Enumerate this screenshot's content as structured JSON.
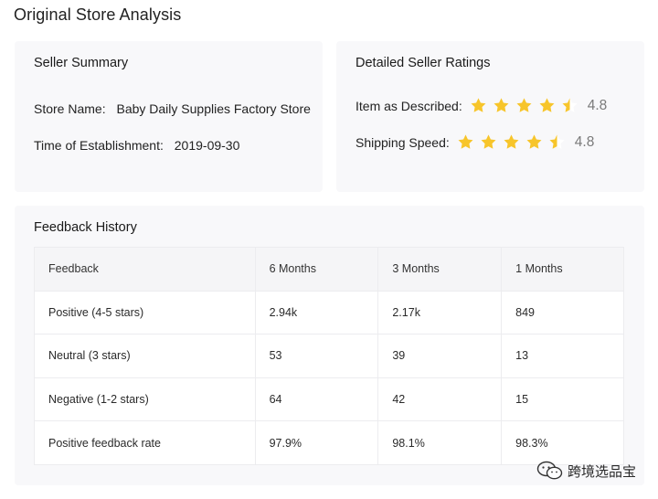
{
  "page": {
    "title": "Original Store Analysis"
  },
  "summary": {
    "title": "Seller Summary",
    "store_name_label": "Store Name:",
    "store_name": "Baby Daily Supplies Factory Store",
    "established_label": "Time of Establishment:",
    "established": "2019-09-30"
  },
  "ratings": {
    "title": "Detailed Seller Ratings",
    "items": [
      {
        "label": "Item as Described:",
        "score": "4.8",
        "stars": 4.5
      },
      {
        "label": "Shipping Speed:",
        "score": "4.8",
        "stars": 4.5
      }
    ],
    "star_color": "#f7c52b"
  },
  "feedback": {
    "title": "Feedback History",
    "headers": [
      "Feedback",
      "6 Months",
      "3 Months",
      "1 Months"
    ],
    "rows": [
      [
        "Positive (4-5 stars)",
        "2.94k",
        "2.17k",
        "849"
      ],
      [
        "Neutral (3 stars)",
        "53",
        "39",
        "13"
      ],
      [
        "Negative (1-2 stars)",
        "64",
        "42",
        "15"
      ],
      [
        "Positive feedback rate",
        "97.9%",
        "98.1%",
        "98.3%"
      ]
    ]
  },
  "watermark": {
    "text": "跨境选品宝",
    "icon": "wechat-icon"
  }
}
